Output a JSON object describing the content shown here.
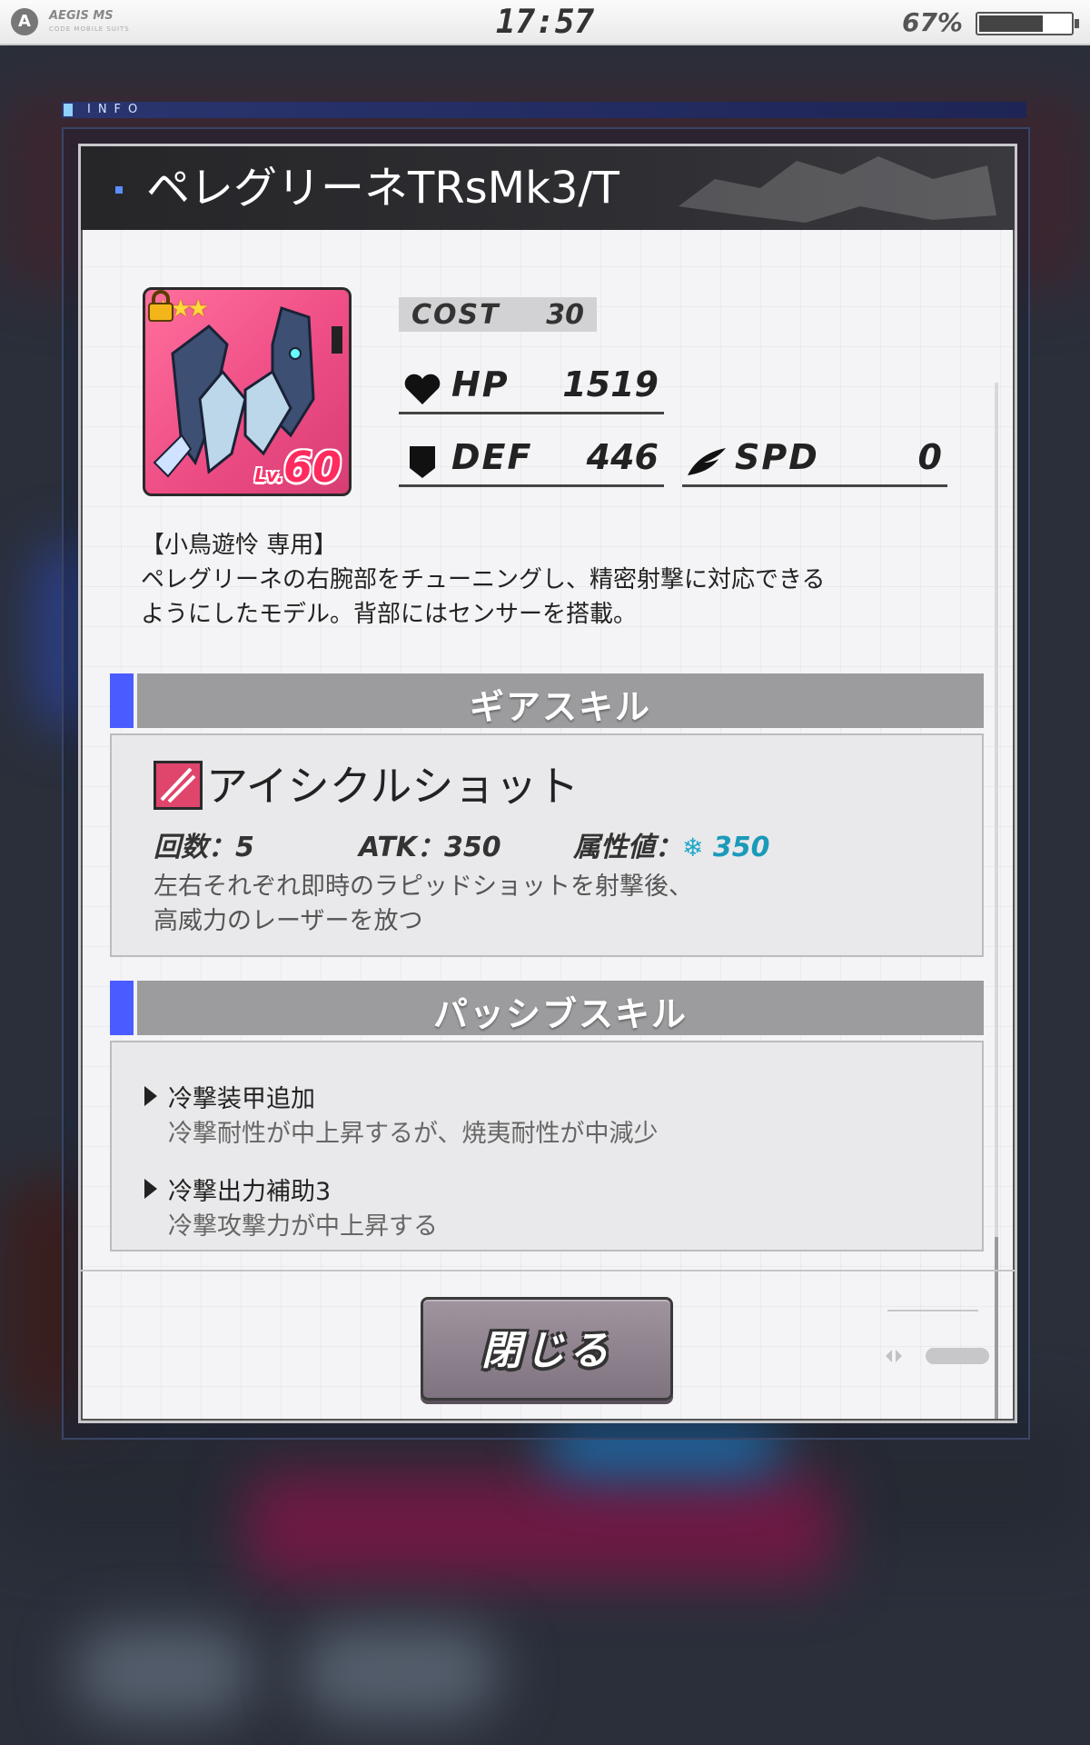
{
  "status_bar": {
    "app_name": "AEGIS MS",
    "app_sub": "CODE MOBILE SUITS",
    "time": "17:57",
    "battery_text": "67%",
    "battery_level": 0.67
  },
  "info_label": "INFO",
  "dialog": {
    "title": "ペレグリーネTRsMk3/T",
    "item": {
      "stars": "★★★",
      "level_prefix": "Lv.",
      "level": "60"
    },
    "stats": {
      "cost_label": "COST",
      "cost_value": "30",
      "hp_label": "HP",
      "hp_value": "1519",
      "def_label": "DEF",
      "def_value": "446",
      "spd_label": "SPD",
      "spd_value": "0"
    },
    "description": {
      "exclusive": "【小鳥遊怜 専用】",
      "line1": "ペレグリーネの右腕部をチューニングし、精密射撃に対応できる",
      "line2": "ようにしたモデル。背部にはセンサーを搭載。"
    },
    "gear_skill": {
      "header": "ギアスキル",
      "name": "アイシクルショット",
      "count": "回数：5",
      "atk": "ATK：350",
      "attr_label": "属性値：",
      "attr_value": "350",
      "desc_line1": "左右それぞれ即時のラピッドショットを射撃後、",
      "desc_line2": "高威力のレーザーを放つ"
    },
    "passive_skill": {
      "header": "パッシブスキル",
      "items": [
        {
          "title": "冷撃装甲追加",
          "desc": "冷撃耐性が中上昇するが、焼夷耐性が中減少"
        },
        {
          "title": "冷撃出力補助3",
          "desc": "冷撃攻撃力が中上昇する"
        }
      ]
    },
    "close_label": "閉じる"
  },
  "colors": {
    "accent": "#4a5cff",
    "card_bg": "#ee4d85",
    "attr": "#1b9ab9"
  }
}
